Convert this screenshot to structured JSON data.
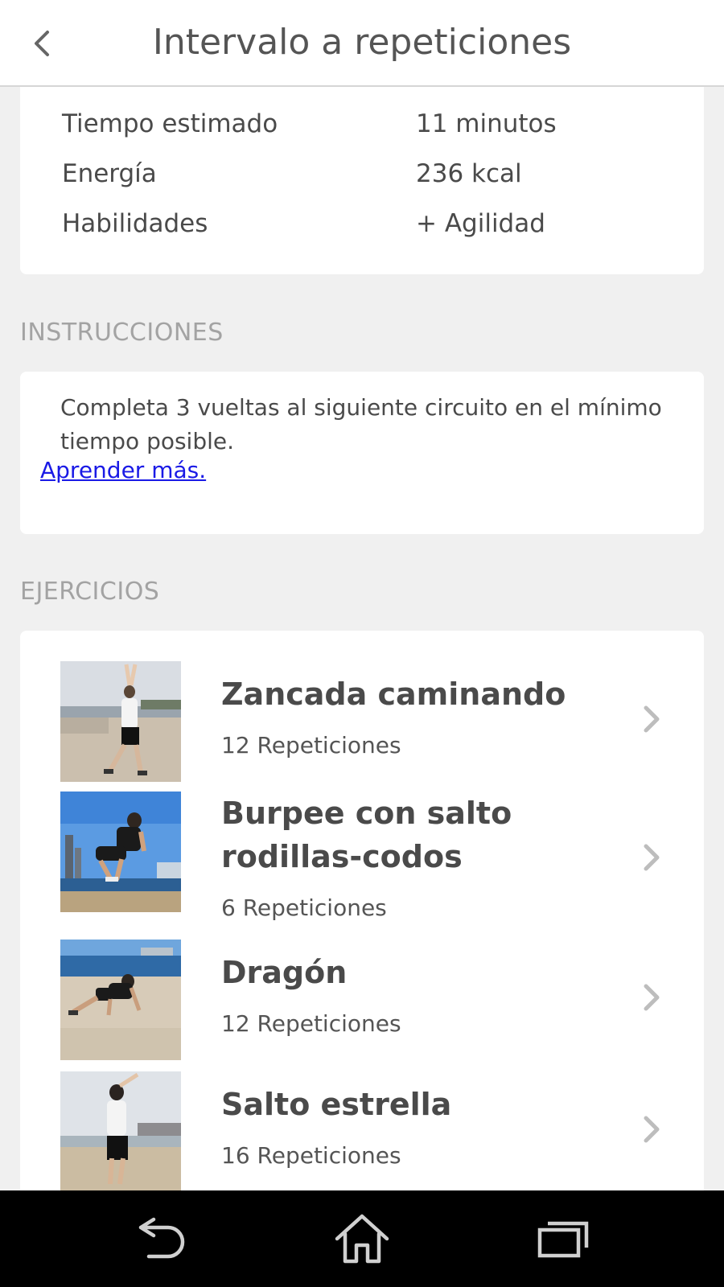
{
  "header": {
    "title": "Intervalo a repeticiones"
  },
  "stats": [
    {
      "label": "Tiempo estimado",
      "value": "11 minutos"
    },
    {
      "label": "Energía",
      "value": "236 kcal"
    },
    {
      "label": "Habilidades",
      "value": "+ Agilidad"
    }
  ],
  "instructions": {
    "heading": "INSTRUCCIONES",
    "text": "Completa 3 vueltas al siguiente circuito en el mínimo tiempo posible.",
    "link": "Aprender más."
  },
  "exercises": {
    "heading": "EJERCICIOS",
    "items": [
      {
        "name": "Zancada caminando",
        "reps": "12 Repeticiones"
      },
      {
        "name": "Burpee con salto rodillas-codos",
        "reps": "6 Repeticiones"
      },
      {
        "name": "Dragón",
        "reps": "12 Repeticiones"
      },
      {
        "name": "Salto estrella",
        "reps": "16 Repeticiones"
      }
    ]
  },
  "icons": {
    "back": "chevron-left-icon",
    "row_arrow": "chevron-right-icon",
    "nav_back": "back-arrow-icon",
    "nav_home": "home-icon",
    "nav_recents": "recent-apps-icon"
  },
  "colors": {
    "link": "#1a1ae6",
    "heading": "#a3a3a3",
    "background": "#f0f0f0"
  }
}
